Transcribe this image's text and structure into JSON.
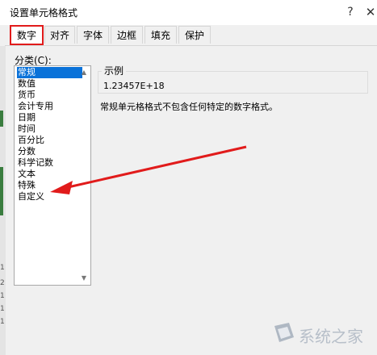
{
  "window": {
    "title": "设置单元格格式",
    "help_glyph": "?",
    "close_glyph": "✕"
  },
  "tabs": [
    {
      "label": "数字",
      "active": true
    },
    {
      "label": "对齐"
    },
    {
      "label": "字体"
    },
    {
      "label": "边框"
    },
    {
      "label": "填充"
    },
    {
      "label": "保护"
    }
  ],
  "category": {
    "label": "分类(C):",
    "items": [
      "常规",
      "数值",
      "货币",
      "会计专用",
      "日期",
      "时间",
      "百分比",
      "分数",
      "科学记数",
      "文本",
      "特殊",
      "自定义"
    ],
    "selected_index": 0
  },
  "sample": {
    "label": "示例",
    "value": "1.23457E+18"
  },
  "description": "常规单元格格式不包含任何特定的数字格式。",
  "background_row_numbers": [
    "1",
    "2",
    "1",
    "1",
    "1"
  ],
  "watermark": {
    "text": "系统之家"
  },
  "colors": {
    "highlight_red": "#e11b1b",
    "selection_blue": "#0a72d9"
  }
}
